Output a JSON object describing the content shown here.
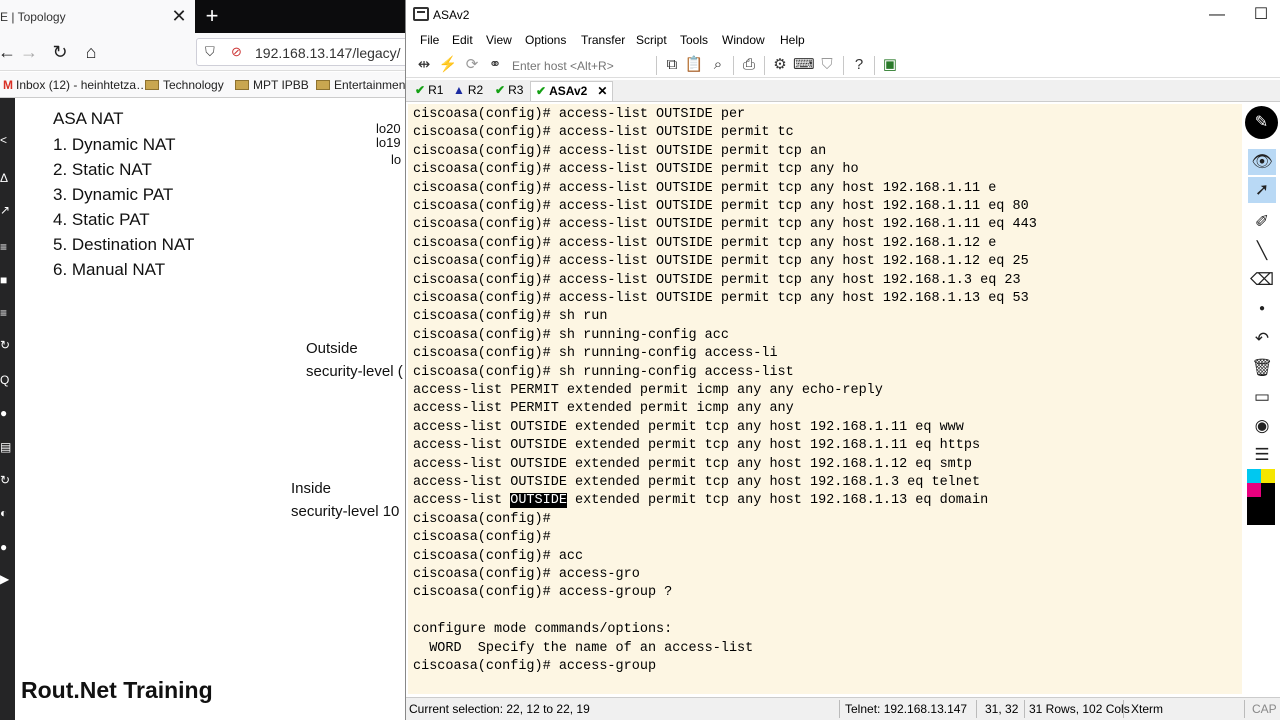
{
  "browser": {
    "tab_title": "E | Topology",
    "url": "192.168.13.147/legacy/",
    "bookmarks": [
      "Inbox (12) - heinhtetza…",
      "Technology",
      "MPT IPBB",
      "Entertainment"
    ],
    "strip_glyphs": [
      "<",
      "Δ",
      "↗",
      "≡",
      "■",
      "≡",
      "↻",
      "Q",
      "●",
      "▤",
      "↻",
      "◐",
      "●",
      "▶"
    ]
  },
  "page": {
    "title": "ASA NAT",
    "items": [
      "1. Dynamic NAT",
      "2. Static NAT",
      "3. Dynamic PAT",
      "4. Static PAT",
      "5. Destination NAT",
      "6. Manual NAT"
    ],
    "loopbacks": [
      "lo20",
      "lo19",
      "lo"
    ],
    "outside_label": "Outside",
    "outside_level": "security-level  (",
    "inside_label": "Inside",
    "inside_level": "security-level  10",
    "brand": "Rout.Net Training"
  },
  "app": {
    "title": "ASAv2",
    "menu": [
      "File",
      "Edit",
      "View",
      "Options",
      "Transfer",
      "Script",
      "Tools",
      "Window",
      "Help"
    ],
    "host_placeholder": "Enter host <Alt+R>",
    "tabs": [
      {
        "label": "R1",
        "icon": "check-icon"
      },
      {
        "label": "R2",
        "icon": "warning-icon"
      },
      {
        "label": "R3",
        "icon": "check-icon"
      },
      {
        "label": "ASAv2",
        "icon": "check-icon",
        "active": true
      }
    ]
  },
  "terminal": {
    "lines": [
      "ciscoasa(config)# access-list OUTSIDE per",
      "ciscoasa(config)# access-list OUTSIDE permit tc",
      "ciscoasa(config)# access-list OUTSIDE permit tcp an",
      "ciscoasa(config)# access-list OUTSIDE permit tcp any ho",
      "ciscoasa(config)# access-list OUTSIDE permit tcp any host 192.168.1.11 e",
      "ciscoasa(config)# access-list OUTSIDE permit tcp any host 192.168.1.11 eq 80",
      "ciscoasa(config)# access-list OUTSIDE permit tcp any host 192.168.1.11 eq 443",
      "ciscoasa(config)# access-list OUTSIDE permit tcp any host 192.168.1.12 e",
      "ciscoasa(config)# access-list OUTSIDE permit tcp any host 192.168.1.12 eq 25",
      "ciscoasa(config)# access-list OUTSIDE permit tcp any host 192.168.1.3 eq 23",
      "ciscoasa(config)# access-list OUTSIDE permit tcp any host 192.168.1.13 eq 53",
      "ciscoasa(config)# sh run",
      "ciscoasa(config)# sh running-config acc",
      "ciscoasa(config)# sh running-config access-li",
      "ciscoasa(config)# sh running-config access-list",
      "access-list PERMIT extended permit icmp any any echo-reply",
      "access-list PERMIT extended permit icmp any any",
      "access-list OUTSIDE extended permit tcp any host 192.168.1.11 eq www",
      "access-list OUTSIDE extended permit tcp any host 192.168.1.11 eq https",
      "access-list OUTSIDE extended permit tcp any host 192.168.1.12 eq smtp",
      "access-list OUTSIDE extended permit tcp any host 192.168.1.3 eq telnet"
    ],
    "highlight_line": {
      "before": "access-list ",
      "selected": "OUTSIDE",
      "after": " extended permit tcp any host 192.168.1.13 eq domain"
    },
    "lines_after": [
      "ciscoasa(config)#",
      "ciscoasa(config)#",
      "ciscoasa(config)# acc",
      "ciscoasa(config)# access-gro",
      "ciscoasa(config)# access-group ?",
      "",
      "configure mode commands/options:",
      "  WORD  Specify the name of an access-list",
      "ciscoasa(config)# access-group"
    ]
  },
  "status": {
    "selection": "Current selection: 22, 12 to 22, 19",
    "telnet": "Telnet: 192.168.13.147",
    "cursor": "31,  32",
    "size": "31 Rows, 102 Cols",
    "term": "Xterm",
    "caps": "CAP"
  },
  "colors": {
    "terminal_bg": "#fdf6e3",
    "swatches": [
      "#00c8f0",
      "#f5e600",
      "#e8007e",
      "#000000"
    ]
  }
}
